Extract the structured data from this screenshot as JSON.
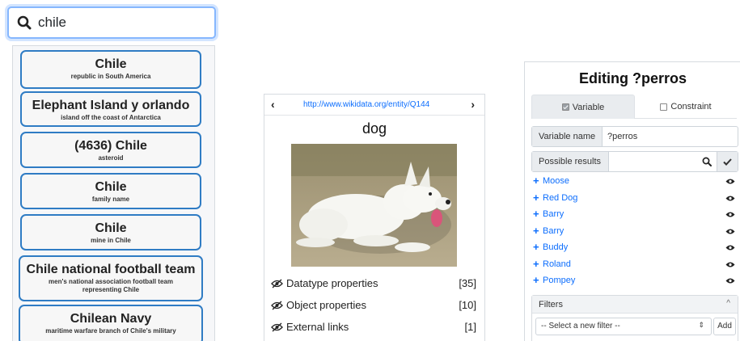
{
  "search": {
    "value": "chile",
    "results": [
      {
        "title": "Chile",
        "description": "republic in South America"
      },
      {
        "title": "Elephant Island y orlando",
        "description": "island off the coast of Antarctica"
      },
      {
        "title": "(4636) Chile",
        "description": "asteroid"
      },
      {
        "title": "Chile",
        "description": "family name"
      },
      {
        "title": "Chile",
        "description": "mine in Chile"
      },
      {
        "title": "Chile national football team",
        "description": "men's national association football team representing Chile"
      },
      {
        "title": "Chilean Navy",
        "description": "maritime warfare branch of Chile's military"
      }
    ]
  },
  "entity": {
    "prev_symbol": "‹",
    "next_symbol": "›",
    "url": "http://www.wikidata.org/entity/Q144",
    "label": "dog",
    "properties": [
      {
        "label": "Datatype properties",
        "count": "[35]"
      },
      {
        "label": "Object properties",
        "count": "[10]"
      },
      {
        "label": "External links",
        "count": "[1]"
      }
    ]
  },
  "editor": {
    "title": "Editing ?perros",
    "tabs": [
      {
        "label": "Variable",
        "checked": true,
        "active": true
      },
      {
        "label": "Constraint",
        "checked": false,
        "active": false
      }
    ],
    "variable_name_label": "Variable name",
    "variable_name_value": "?perros",
    "possible_results_label": "Possible results",
    "possible_results": [
      "Moose",
      "Red Dog",
      "Barry",
      "Barry",
      "Buddy",
      "Roland",
      "Pompey"
    ],
    "filters_label": "Filters",
    "filter_placeholder": "-- Select a new filter --",
    "add_label": "Add"
  },
  "colors": {
    "accent": "#0d6efd",
    "card_border": "#2f7cc4",
    "search_focus": "#86b7fe"
  }
}
